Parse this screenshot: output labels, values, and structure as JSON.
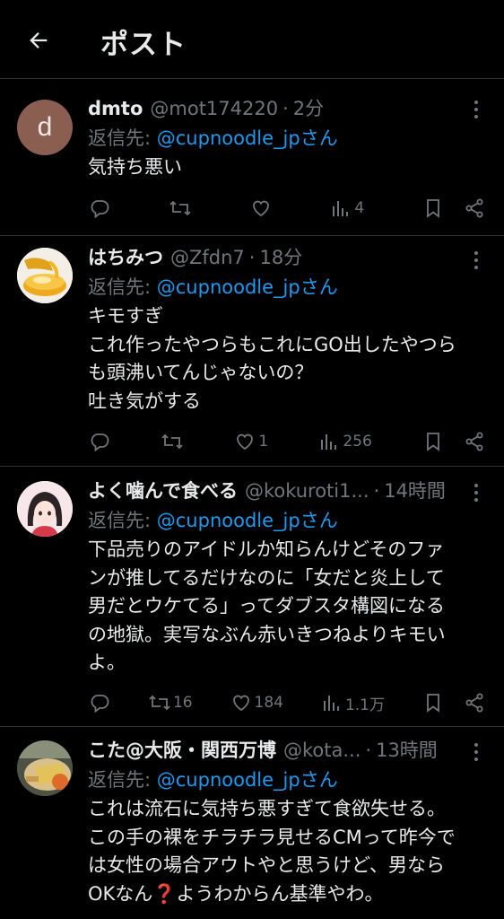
{
  "header": {
    "title": "ポスト"
  },
  "posts": [
    {
      "name": "dmto",
      "handle": "@mot174220",
      "time": "2分",
      "reply_prefix": "返信先: ",
      "reply_to": "@cupnoodle_jpさん",
      "text": "気持ち悪い",
      "avatar_letter": "d",
      "counts": {
        "reply": "",
        "repost": "",
        "like": "",
        "views": "4"
      }
    },
    {
      "name": "はちみつ",
      "handle": "@Zfdn7",
      "time": "18分",
      "reply_prefix": "返信先: ",
      "reply_to": "@cupnoodle_jpさん",
      "text": "キモすぎ\nこれ作ったやつらもこれにGO出したやつら\nも頭沸いてんじゃないの？\n吐き気がする",
      "counts": {
        "reply": "",
        "repost": "",
        "like": "1",
        "views": "256"
      }
    },
    {
      "name": "よく噛んで食べる",
      "handle": "@kokuroti1...",
      "time": "14時間",
      "reply_prefix": "返信先: ",
      "reply_to": "@cupnoodle_jpさん",
      "text": "下品売りのアイドルか知らんけどそのファ\nンが推してるだけなのに「女だと炎上して\n男だとウケてる」ってダブスタ構図になる\nの地獄。実写なぶん赤いきつねよりキモい\nよ。",
      "counts": {
        "reply": "",
        "repost": "16",
        "like": "184",
        "views": "1.1万"
      }
    },
    {
      "name": "こた@大阪・関西万博",
      "handle": "@kota...",
      "time": "13時間",
      "reply_prefix": "返信先: ",
      "reply_to": "@cupnoodle_jpさん",
      "text": "これは流石に気持ち悪すぎて食欲失せる。\nこの手の裸をチラチラ見せるCMって昨今で\nは女性の場合アウトやと思うけど、男なら\nOKなん❓ようわからん基準やわ。"
    }
  ],
  "colors": {
    "background": "#000000",
    "text": "#e7e9ea",
    "muted": "#71767b",
    "link": "#1d9bf0",
    "divider": "#2f3336"
  },
  "icons": {
    "back": "arrow-left-icon",
    "more": "more-vertical-icon",
    "reply": "reply-icon",
    "repost": "repost-icon",
    "like": "heart-icon",
    "views": "views-chart-icon",
    "bookmark": "bookmark-icon",
    "share": "share-icon"
  }
}
